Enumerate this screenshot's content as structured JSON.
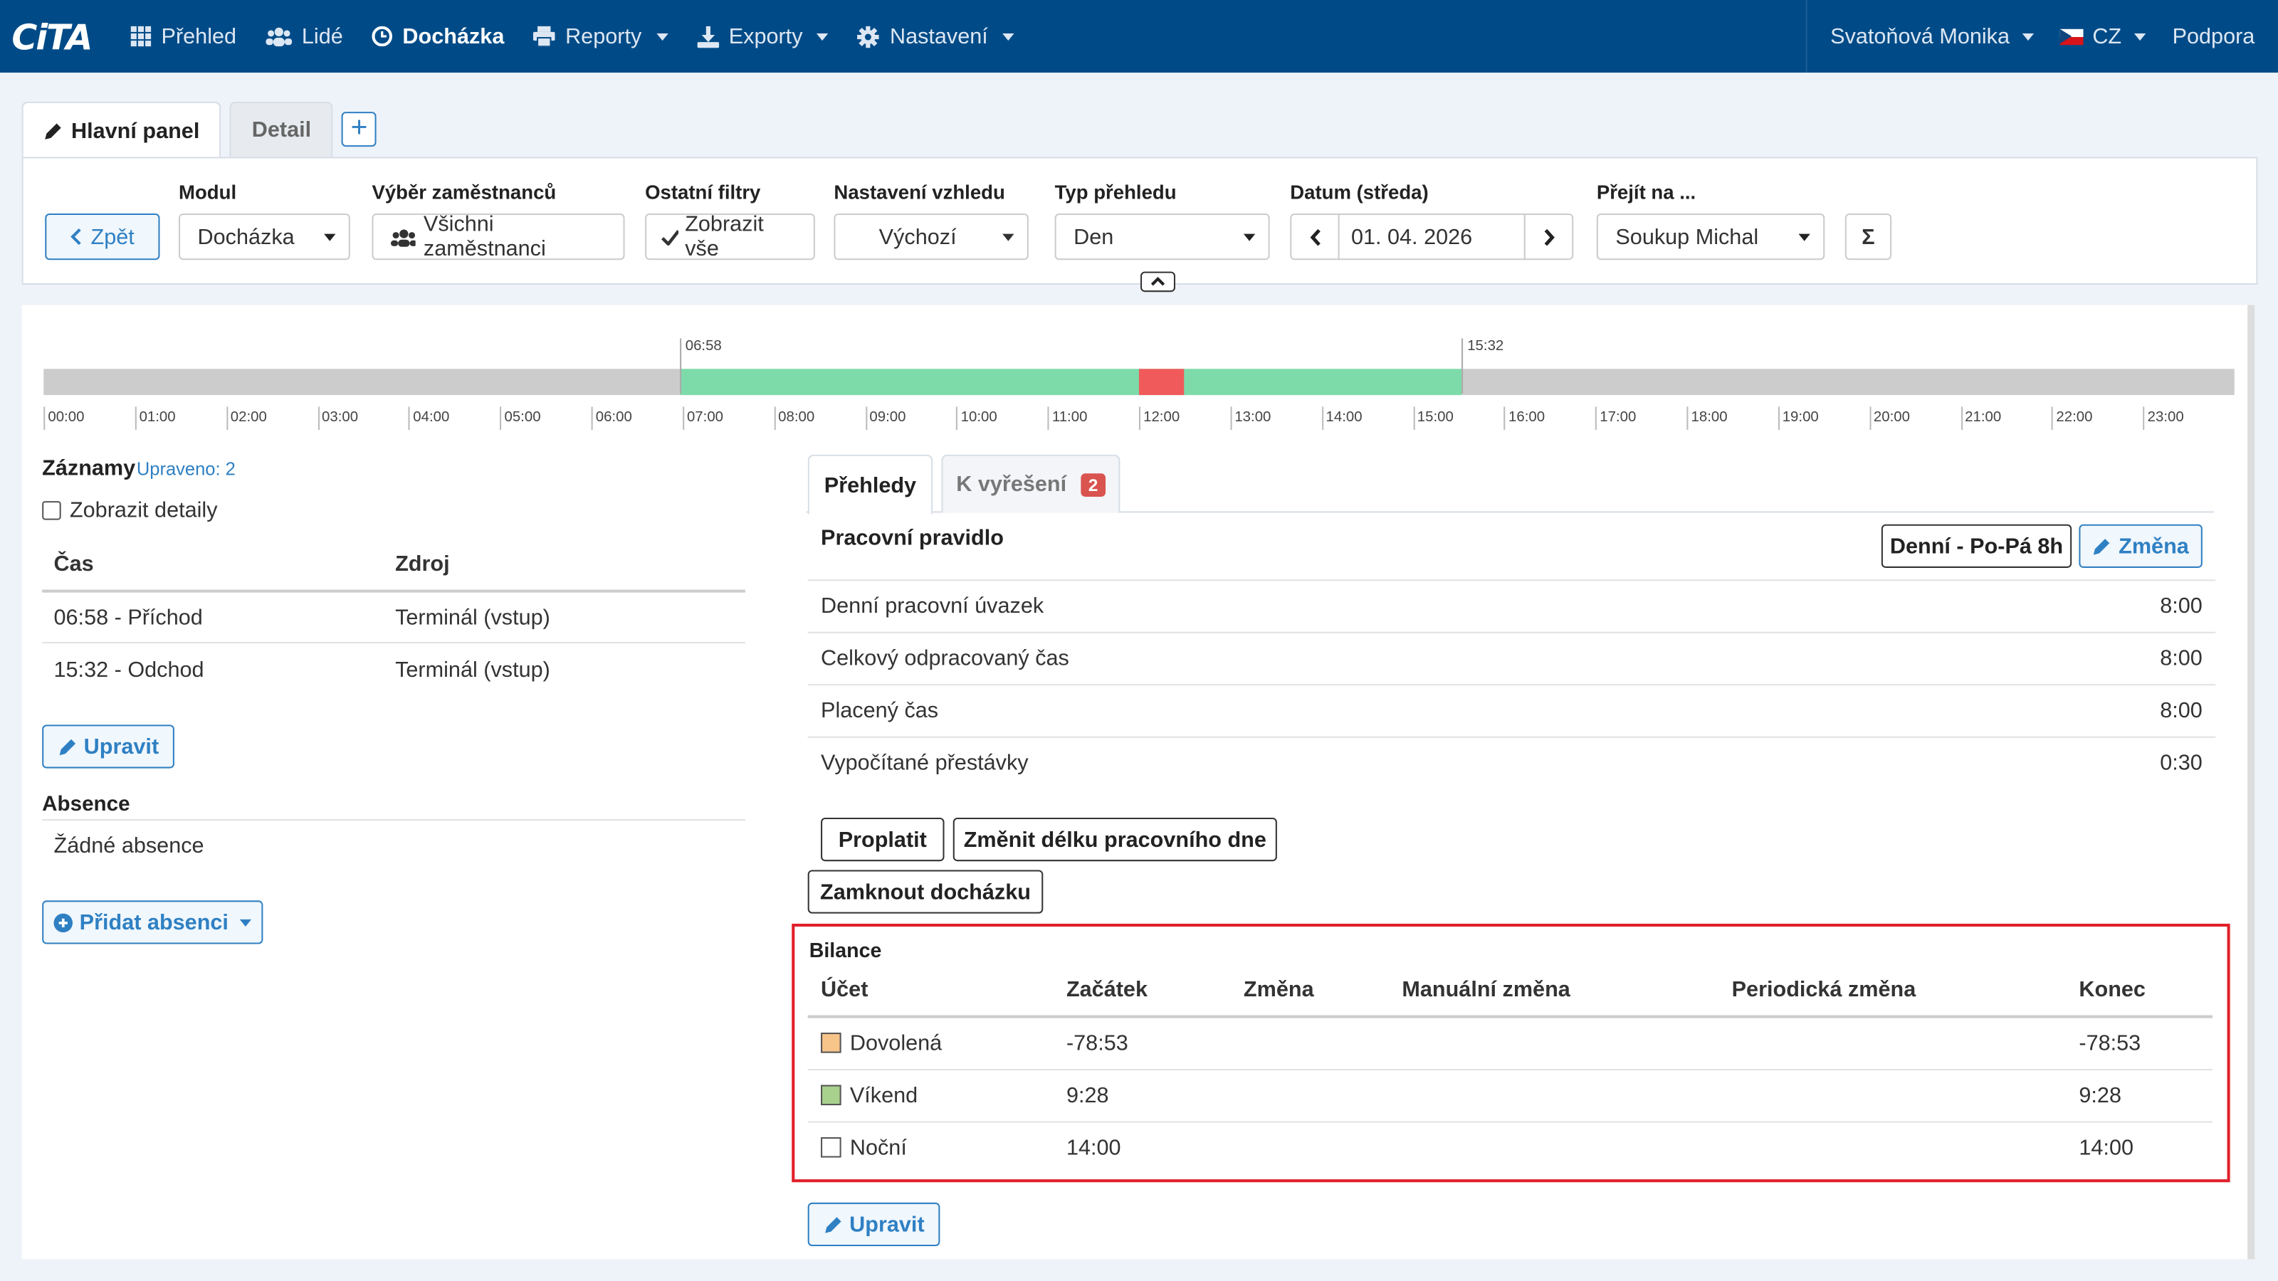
{
  "app": {
    "logo": "CiTA"
  },
  "nav": {
    "items": [
      {
        "label": "Přehled",
        "icon": "grid-icon"
      },
      {
        "label": "Lidé",
        "icon": "users-icon"
      },
      {
        "label": "Docházka",
        "icon": "clock-icon",
        "active": true
      },
      {
        "label": "Reporty",
        "icon": "print-icon"
      },
      {
        "label": "Exporty",
        "icon": "download-icon"
      },
      {
        "label": "Nastavení",
        "icon": "gear-icon"
      }
    ],
    "user": "Svatoňová Monika",
    "lang": "CZ",
    "support": "Podpora"
  },
  "tabs": {
    "main": "Hlavní panel",
    "detail": "Detail",
    "add": "+"
  },
  "filters": {
    "back": "Zpět",
    "module_label": "Modul",
    "module_value": "Docházka",
    "employees_label": "Výběr zaměstnanců",
    "employees_value": "Všichni zaměstnanci",
    "other_label": "Ostatní filtry",
    "other_value": "Zobrazit vše",
    "view_label": "Nastavení vzhledu",
    "view_value": "Výchozí",
    "type_label": "Typ přehledu",
    "type_value": "Den",
    "date_label": "Datum (středa)",
    "date_value": "01. 04. 2026",
    "goto_label": "Přejít na ...",
    "goto_value": "Soukup Michal",
    "sum": "Σ"
  },
  "timeline": {
    "start_label": "06:58",
    "end_label": "15:32",
    "start_min": 418,
    "end_min": 932,
    "break_start_min": 720,
    "break_end_min": 750,
    "hours": [
      "00:00",
      "01:00",
      "02:00",
      "03:00",
      "04:00",
      "05:00",
      "06:00",
      "07:00",
      "08:00",
      "09:00",
      "10:00",
      "11:00",
      "12:00",
      "13:00",
      "14:00",
      "15:00",
      "16:00",
      "17:00",
      "18:00",
      "19:00",
      "20:00",
      "21:00",
      "22:00",
      "23:00"
    ],
    "colors": {
      "work": "#7ddbaa",
      "break": "#f05a5a",
      "idle": "#cccccc"
    }
  },
  "records": {
    "title": "Záznamy",
    "modified": "Upraveno: 2",
    "show_details": "Zobrazit detaily",
    "col_time": "Čas",
    "col_source": "Zdroj",
    "rows": [
      {
        "time": "06:58 - Příchod",
        "source": "Terminál (vstup)"
      },
      {
        "time": "15:32 - Odchod",
        "source": "Terminál (vstup)"
      }
    ],
    "edit": "Upravit"
  },
  "absence": {
    "title": "Absence",
    "none": "Žádné absence",
    "add": "Přidat absenci"
  },
  "overview": {
    "tab1": "Přehledy",
    "tab2": "K vyřešení",
    "tab2_badge": "2",
    "rule_label": "Pracovní pravidlo",
    "rule_value": "Denní - Po-Pá 8h",
    "change": "Změna",
    "rows": [
      {
        "label": "Denní pracovní úvazek",
        "value": "8:00"
      },
      {
        "label": "Celkový odpracovaný čas",
        "value": "8:00"
      },
      {
        "label": "Placený čas",
        "value": "8:00"
      },
      {
        "label": "Vypočítané přestávky",
        "value": "0:30"
      }
    ],
    "pay": "Proplatit",
    "change_len": "Změnit délku pracovního dne",
    "lock": "Zamknout docházku"
  },
  "balance": {
    "title": "Bilance",
    "cols": [
      "Účet",
      "Začátek",
      "Změna",
      "Manuální změna",
      "Periodická změna",
      "Konec"
    ],
    "rows": [
      {
        "account": "Dovolená",
        "color": "#f7c48a",
        "start": "-78:53",
        "end": "-78:53"
      },
      {
        "account": "Víkend",
        "color": "#a9d18e",
        "start": "9:28",
        "end": "9:28"
      },
      {
        "account": "Noční",
        "color": "#ffffff",
        "start": "14:00",
        "end": "14:00"
      }
    ],
    "highlight": "#e0202a",
    "edit": "Upravit"
  }
}
